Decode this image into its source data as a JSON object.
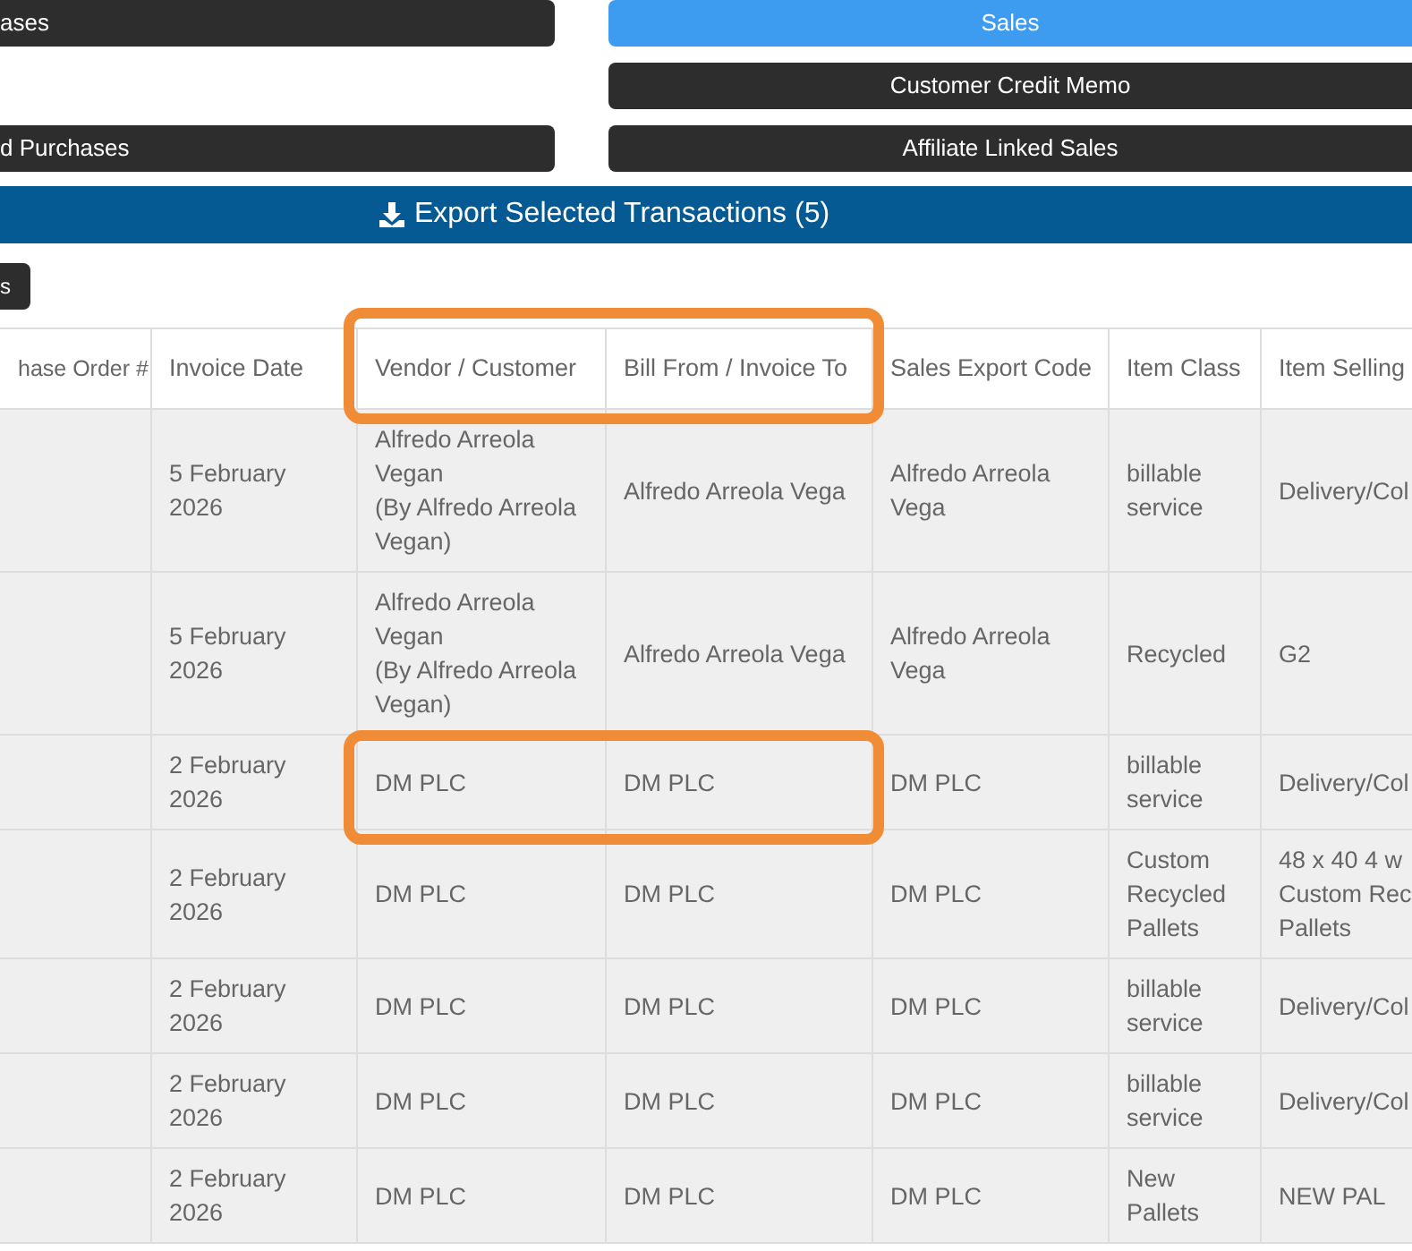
{
  "left_buttons": [
    {
      "label": "ases",
      "selected": false
    },
    {
      "label": "d Purchases",
      "selected": false
    }
  ],
  "right_buttons": [
    {
      "label": "Sales",
      "selected": true
    },
    {
      "label": "Customer Credit Memo",
      "selected": false
    },
    {
      "label": "Affiliate Linked Sales",
      "selected": false
    }
  ],
  "export_button": {
    "label": "Export Selected Transactions (5)"
  },
  "small_button": {
    "label": "s"
  },
  "table": {
    "columns": [
      {
        "label": "hase Order #",
        "highlighted": false
      },
      {
        "label": "Invoice Date",
        "highlighted": false
      },
      {
        "label": "Vendor / Customer",
        "highlighted": true
      },
      {
        "label": "Bill From / Invoice To",
        "highlighted": true
      },
      {
        "label": "Sales Export Code",
        "highlighted": false
      },
      {
        "label": "Item Class",
        "highlighted": false
      },
      {
        "label": "Item Selling",
        "highlighted": false
      }
    ],
    "rows": [
      {
        "highlighted": false,
        "cells": [
          "",
          "5 February 2026",
          "Alfredo Arreola Vegan\n(By Alfredo Arreola Vegan)",
          "Alfredo Arreola Vega",
          "Alfredo Arreola Vega",
          "billable service",
          "Delivery/Col"
        ]
      },
      {
        "highlighted": false,
        "cells": [
          "",
          "5 February 2026",
          "Alfredo Arreola Vegan\n(By Alfredo Arreola Vegan)",
          "Alfredo Arreola Vega",
          "Alfredo Arreola Vega",
          "Recycled",
          "G2"
        ]
      },
      {
        "highlighted": true,
        "cells": [
          "",
          "2 February 2026",
          "DM PLC",
          "DM PLC",
          "DM PLC",
          "billable service",
          "Delivery/Col"
        ]
      },
      {
        "highlighted": false,
        "cells": [
          "",
          "2 February 2026",
          "DM PLC",
          "DM PLC",
          "DM PLC",
          "Custom Recycled Pallets",
          "48 x 40 4 w\nCustom Rec\nPallets"
        ]
      },
      {
        "highlighted": false,
        "cells": [
          "",
          "2 February 2026",
          "DM PLC",
          "DM PLC",
          "DM PLC",
          "billable service",
          "Delivery/Col"
        ]
      },
      {
        "highlighted": false,
        "cells": [
          "",
          "2 February 2026",
          "DM PLC",
          "DM PLC",
          "DM PLC",
          "billable service",
          "Delivery/Col"
        ]
      },
      {
        "highlighted": false,
        "cells": [
          "",
          "2 February 2026",
          "DM PLC",
          "DM PLC",
          "DM PLC",
          "New Pallets",
          "NEW PAL"
        ]
      }
    ]
  }
}
